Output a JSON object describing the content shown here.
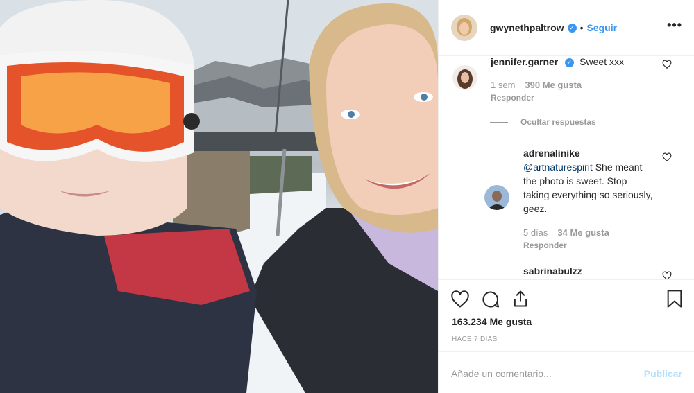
{
  "post": {
    "author": "gwynethpaltrow",
    "separator": "•",
    "follow_label": "Seguir",
    "more_icon": "more-options-icon",
    "verified_icon": "verified-badge-icon"
  },
  "comments": [
    {
      "user": "jennifer.garner",
      "verified": true,
      "text": "Sweet xxx",
      "age": "1 sem",
      "likes": "390 Me gusta",
      "reply_label": "Responder"
    },
    {
      "user": "adrenalinike",
      "mention": "@artnaturespirit",
      "text": " She meant the photo is sweet. Stop taking everything so seriously, geez.",
      "age": "5 días",
      "likes": "34 Me gusta",
      "reply_label": "Responder"
    },
    {
      "user": "sabrinabulzz"
    }
  ],
  "hide_replies_label": "Ocultar respuestas",
  "actions": {
    "like_icon": "heart-icon",
    "comment_icon": "comment-icon",
    "share_icon": "share-icon",
    "save_icon": "bookmark-icon",
    "likes_count": "163.234 Me gusta",
    "posted_ago": "HACE 7 DÍAS"
  },
  "add_comment": {
    "placeholder": "Añade un comentario...",
    "publish_label": "Publicar"
  },
  "colors": {
    "link_blue": "#3897f0",
    "publish_disabled": "#b2dffc",
    "muted": "#999999",
    "text": "#262626"
  }
}
